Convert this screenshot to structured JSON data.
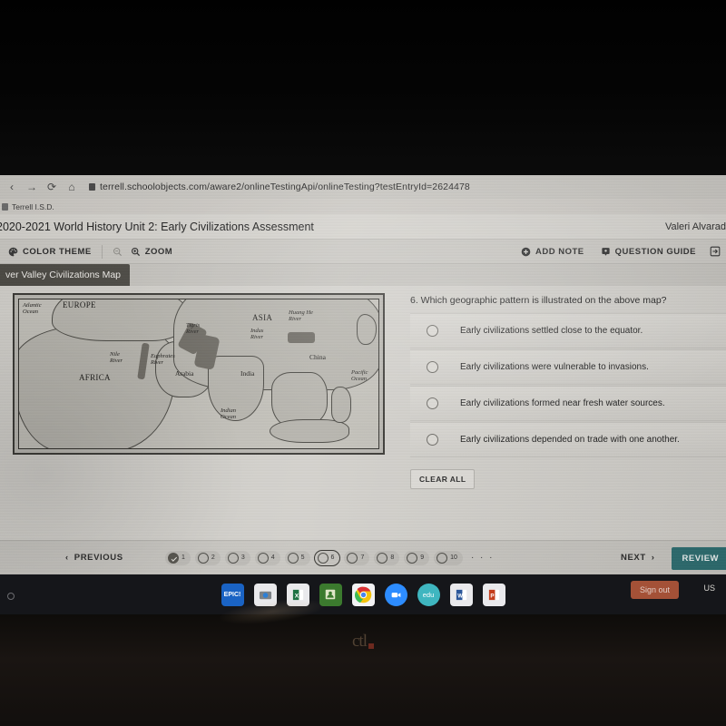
{
  "browser": {
    "url": "terrell.schoolobjects.com/aware2/onlineTestingApi/onlineTesting?testEntryId=2624478",
    "bookmark": "Terrell I.S.D.",
    "forward_icon": "forward-arrow-icon",
    "reload_icon": "reload-icon",
    "bookmark_icon": "bookmark-icon",
    "lock_icon": "site-info-icon"
  },
  "header": {
    "title": "2020-2021 World History Unit 2: Early Civilizations Assessment",
    "user": "Valeri Alvarad"
  },
  "toolbar": {
    "color_theme": "COLOR THEME",
    "zoom": "ZOOM",
    "add_note": "ADD NOTE",
    "question_guide": "QUESTION GUIDE",
    "palette_icon": "palette-icon",
    "zoom_out_icon": "zoom-out-icon",
    "zoom_in_icon": "zoom-in-icon",
    "add_note_icon": "plus-circle-icon",
    "question_guide_icon": "bookmark-flag-icon",
    "exit_icon": "exit-icon"
  },
  "tabs": {
    "active": "ver Valley Civilizations Map"
  },
  "map": {
    "title": "River Valley Civilizations Map",
    "labels": [
      {
        "text": "Atlantic\nOcean",
        "kind": "ocean"
      },
      {
        "text": "EUROPE",
        "kind": "region"
      },
      {
        "text": "AFRICA",
        "kind": "region"
      },
      {
        "text": "ASIA",
        "kind": "region"
      },
      {
        "text": "Nile\nRiver",
        "kind": "river"
      },
      {
        "text": "Tigris\nRiver",
        "kind": "river"
      },
      {
        "text": "Euphrates\nRiver",
        "kind": "river"
      },
      {
        "text": "Indus\nRiver",
        "kind": "river"
      },
      {
        "text": "Huang He\nRiver",
        "kind": "river"
      },
      {
        "text": "Arabia",
        "kind": "place"
      },
      {
        "text": "India",
        "kind": "place"
      },
      {
        "text": "China",
        "kind": "place"
      },
      {
        "text": "Indian\nOcean",
        "kind": "ocean"
      },
      {
        "text": "Pacific\nOcean",
        "kind": "ocean"
      }
    ],
    "label_atlantic_1": "Atlantic",
    "label_atlantic_2": "Ocean",
    "label_europe": "EUROPE",
    "label_africa": "AFRICA",
    "label_asia": "ASIA",
    "label_nile_1": "Nile",
    "label_nile_2": "River",
    "label_tigris_1": "Tigris",
    "label_tigris_2": "River",
    "label_euphrates_1": "Euphrates",
    "label_euphrates_2": "River",
    "label_indus_1": "Indus",
    "label_indus_2": "River",
    "label_huanghe_1": "Huang He",
    "label_huanghe_2": "River",
    "label_arabia": "Arabia",
    "label_india": "India",
    "label_china": "China",
    "label_indian_1": "Indian",
    "label_indian_2": "Ocean",
    "label_pacific_1": "Pacific",
    "label_pacific_2": "Ocean"
  },
  "question": {
    "number": "6.",
    "stem": "6. Which geographic pattern is illustrated on the above map?",
    "options": [
      {
        "label": "Early civilizations settled close to the equator.",
        "selected": false
      },
      {
        "label": "Early civilizations were vulnerable to invasions.",
        "selected": false
      },
      {
        "label": "Early civilizations formed near fresh water sources.",
        "selected": false
      },
      {
        "label": "Early civilizations depended on trade with one another.",
        "selected": false
      }
    ],
    "clear_all": "CLEAR ALL"
  },
  "bottom_nav": {
    "previous": "PREVIOUS",
    "next": "NEXT",
    "review": "REVIEW",
    "more": "· · ·",
    "questions": [
      {
        "num": "1",
        "state": "answered"
      },
      {
        "num": "2",
        "state": "unanswered"
      },
      {
        "num": "3",
        "state": "unanswered"
      },
      {
        "num": "4",
        "state": "unanswered"
      },
      {
        "num": "5",
        "state": "unanswered"
      },
      {
        "num": "6",
        "state": "current"
      },
      {
        "num": "7",
        "state": "unanswered"
      },
      {
        "num": "8",
        "state": "unanswered"
      },
      {
        "num": "9",
        "state": "unanswered"
      },
      {
        "num": "10",
        "state": "unanswered"
      }
    ]
  },
  "shelf": {
    "apps": [
      {
        "name": "epic-app-icon",
        "label": "EPIC!"
      },
      {
        "name": "camera-app-icon",
        "label": ""
      },
      {
        "name": "excel-app-icon",
        "label": "X"
      },
      {
        "name": "classroom-app-icon",
        "label": ""
      },
      {
        "name": "chrome-app-icon",
        "label": ""
      },
      {
        "name": "zoom-app-icon",
        "label": ""
      },
      {
        "name": "edu-app-icon",
        "label": "edu"
      },
      {
        "name": "word-app-icon",
        "label": "W"
      },
      {
        "name": "powerpoint-app-icon",
        "label": "P"
      }
    ],
    "sign_out": "Sign out",
    "locale": "US"
  },
  "device": {
    "brand": "ctl"
  },
  "colors": {
    "review_button": "#2f6f72",
    "sign_out": "#b1563a",
    "tab_active": "#4e4c46",
    "shelf": "#15161a"
  }
}
